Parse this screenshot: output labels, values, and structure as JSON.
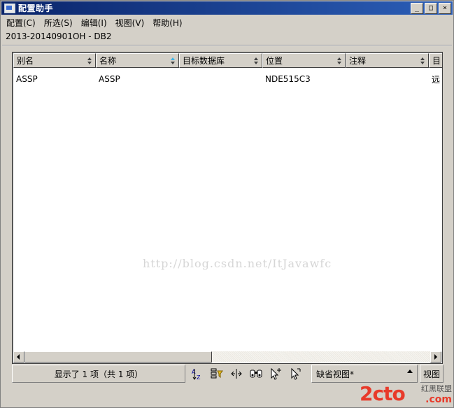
{
  "window": {
    "title": "配置助手",
    "controls": [
      "_",
      "□",
      "×"
    ]
  },
  "menu": [
    "配置(C)",
    "所选(S)",
    "编辑(I)",
    "视图(V)",
    "帮助(H)"
  ],
  "subtitle": "2013-20140901OH - DB2",
  "table": {
    "columns": [
      {
        "label": "别名",
        "sorted": false
      },
      {
        "label": "名称",
        "sorted": true
      },
      {
        "label": "目标数据库",
        "sorted": false
      },
      {
        "label": "位置",
        "sorted": false
      },
      {
        "label": "注释",
        "sorted": false
      },
      {
        "label": "目",
        "sorted": false
      }
    ],
    "rows": [
      [
        "ASSP",
        "ASSP",
        "",
        "NDE515C3",
        "",
        "远"
      ]
    ]
  },
  "watermark": "http://blog.csdn.net/ItJavawfc",
  "status": {
    "count_text": "显示了 1 项（共 1 项）",
    "view_name": "缺省视图*",
    "view_button": "视图"
  },
  "toolbar_icons": [
    "sort-icon",
    "filter-icon",
    "columns-icon",
    "find-icon",
    "select-plus-icon",
    "select-pointer-icon"
  ],
  "logo": {
    "brand": "2cto",
    "union": "红黑联盟",
    "domain": ".com"
  },
  "colors": {
    "title_bar": "#0a246a",
    "sort_active": "#3cb4e6",
    "logo_red": "#e83a2a"
  }
}
